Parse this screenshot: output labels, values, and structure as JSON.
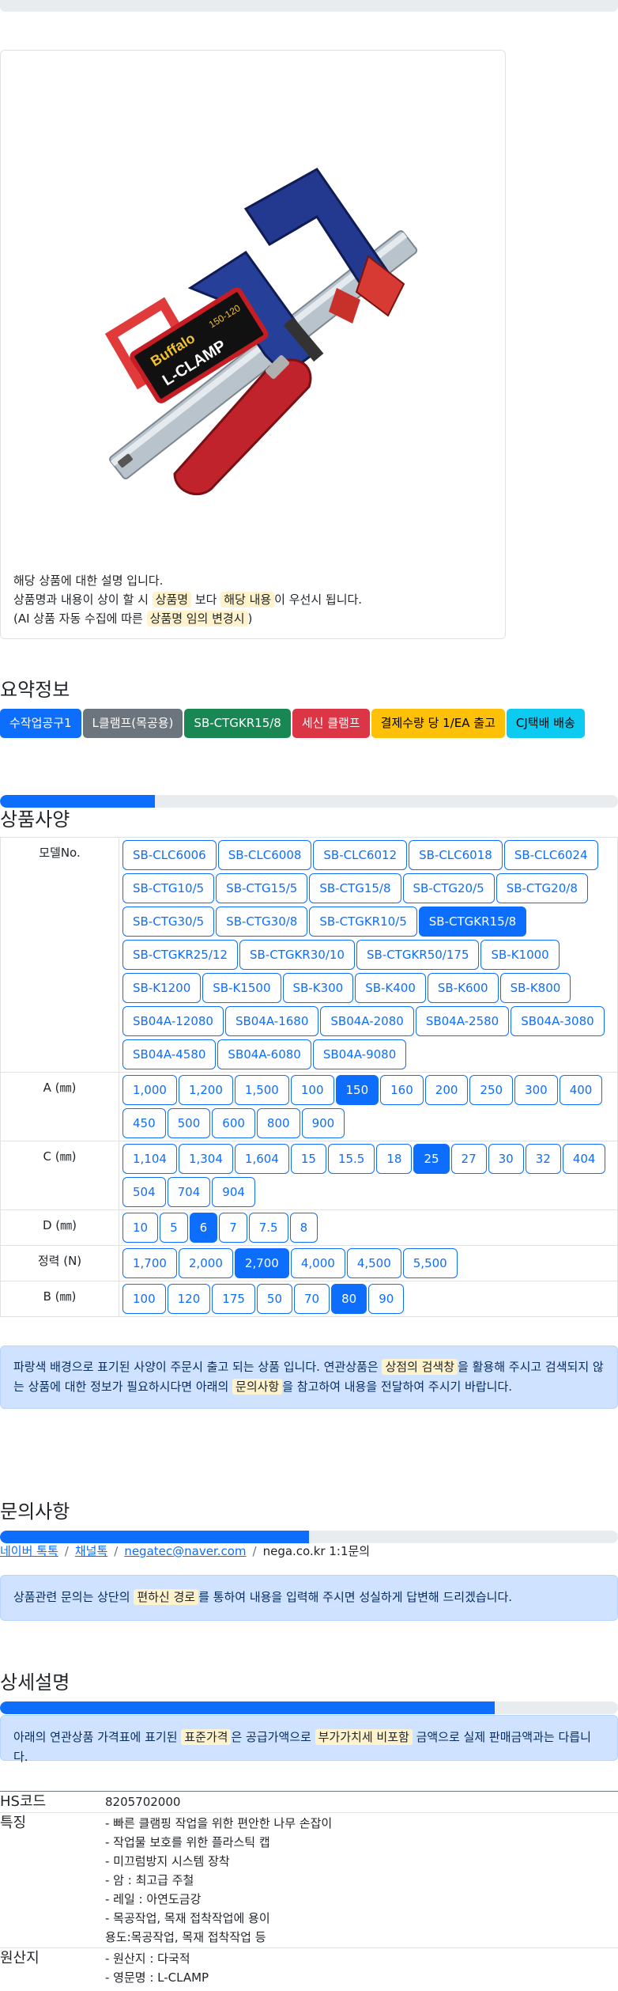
{
  "description": {
    "line1": "해당 상품에 대한 설명 입니다.",
    "line2_pre": "상품명과 내용이 상이 할 시 ",
    "line2_mark1": "상품명",
    "line2_mid": " 보다 ",
    "line2_mark2": "해당 내용",
    "line2_post": "이 우선시 됩니다.",
    "line3_pre": "(AI 상품 자동 수집에 따른 ",
    "line3_mark": "상품명 임의 변경시",
    "line3_post": ")"
  },
  "product_image_text": {
    "brand": "Buffalo",
    "model": "L-CLAMP",
    "size": "150-120"
  },
  "summary": {
    "title": "요약정보",
    "badges": [
      {
        "label": "수작업공구1",
        "bg": "#0d6efd",
        "fg": "#ffffff"
      },
      {
        "label": "L클램프(목공용)",
        "bg": "#6c757d",
        "fg": "#ffffff"
      },
      {
        "label": "SB-CTGKR15/8",
        "bg": "#198754",
        "fg": "#ffffff"
      },
      {
        "label": "세신 클램프",
        "bg": "#dc3545",
        "fg": "#ffffff"
      },
      {
        "label": "결제수량 당 1/EA 출고",
        "bg": "#ffc107",
        "fg": "#000000"
      },
      {
        "label": "CJ택배 배송",
        "bg": "#0dcaf0",
        "fg": "#000000"
      }
    ]
  },
  "specs": {
    "title": "상품사양",
    "progress": 0.25,
    "rows": [
      {
        "label": "모델No.",
        "options": [
          "SB-CLC6006",
          "SB-CLC6008",
          "SB-CLC6012",
          "SB-CLC6018",
          "SB-CLC6024",
          "SB-CTG10/5",
          "SB-CTG15/5",
          "SB-CTG15/8",
          "SB-CTG20/5",
          "SB-CTG20/8",
          "SB-CTG30/5",
          "SB-CTG30/8",
          "SB-CTGKR10/5",
          "SB-CTGKR15/8",
          "SB-CTGKR25/12",
          "SB-CTGKR30/10",
          "SB-CTGKR50/175",
          "SB-K1000",
          "SB-K1200",
          "SB-K1500",
          "SB-K300",
          "SB-K400",
          "SB-K600",
          "SB-K800",
          "SB04A-12080",
          "SB04A-1680",
          "SB04A-2080",
          "SB04A-2580",
          "SB04A-3080",
          "SB04A-4580",
          "SB04A-6080",
          "SB04A-9080"
        ],
        "selected": "SB-CTGKR15/8"
      },
      {
        "label": "A (㎜)",
        "options": [
          "1,000",
          "1,200",
          "1,500",
          "100",
          "150",
          "160",
          "200",
          "250",
          "300",
          "400",
          "450",
          "500",
          "600",
          "800",
          "900"
        ],
        "selected": "150"
      },
      {
        "label": "C (㎜)",
        "options": [
          "1,104",
          "1,304",
          "1,604",
          "15",
          "15.5",
          "18",
          "25",
          "27",
          "30",
          "32",
          "404",
          "504",
          "704",
          "904"
        ],
        "selected": "25"
      },
      {
        "label": "D (㎜)",
        "options": [
          "10",
          "5",
          "6",
          "7",
          "7.5",
          "8"
        ],
        "selected": "6"
      },
      {
        "label": "정력 (N)",
        "options": [
          "1,700",
          "2,000",
          "2,700",
          "4,000",
          "4,500",
          "5,500"
        ],
        "selected": "2,700"
      },
      {
        "label": "B (㎜)",
        "options": [
          "100",
          "120",
          "175",
          "50",
          "70",
          "80",
          "90"
        ],
        "selected": "80"
      }
    ],
    "notice_pre": "파랑색 배경으로 표기된 사양이 주문시 출고 되는 상품 입니다. 연관상품은 ",
    "notice_mark1": "상점의 검색창",
    "notice_mid": "을 활용해 주시고 검색되지 않는 상품에 대한 정보가 필요하시다면 아래의 ",
    "notice_mark2": "문의사항",
    "notice_post": "을 참고하여 내용을 전달하여 주시기 바랍니다."
  },
  "inquiry": {
    "title": "문의사항",
    "progress": 0.5,
    "links": [
      "네이버 톡톡",
      "채널톡",
      "negatec@naver.com"
    ],
    "plain": "nega.co.kr 1:1문의",
    "separator": "/",
    "notice_pre": "상품관련 문의는 상단의 ",
    "notice_mark": "편하신 경로",
    "notice_post": "를 통하여 내용을 입력해 주시면 성실하게 답변해 드리겠습니다."
  },
  "detail": {
    "title": "상세설명",
    "progress": 0.8,
    "notice_pre": "아래의 연관상품 가격표에 표기된 ",
    "notice_mark1": "표준가격",
    "notice_mid": "은 공급가액으로 ",
    "notice_mark2": "부가가치세 비포함",
    "notice_post": " 금액으로 실제 판매금액과는 다릅니다.",
    "rows": [
      {
        "key": "HS코드",
        "lines": [
          "8205702000"
        ]
      },
      {
        "key": "특징",
        "lines": [
          "- 빠른 클램핑 작업을 위한 편안한 나무 손잡이",
          "- 작업물 보호를 위한 플라스틱 캡",
          "- 미끄럼방지 시스템 장착",
          "- 암 : 최고급 주철",
          "- 레일 : 아연도금강",
          "- 목공작업, 목재 접착작업에 용이",
          "용도:목공작업, 목재 접착작업 등"
        ]
      },
      {
        "key": "원산지",
        "lines": [
          "- 원산지 : 다국적",
          "- 영문명 : L-CLAMP"
        ]
      }
    ]
  }
}
